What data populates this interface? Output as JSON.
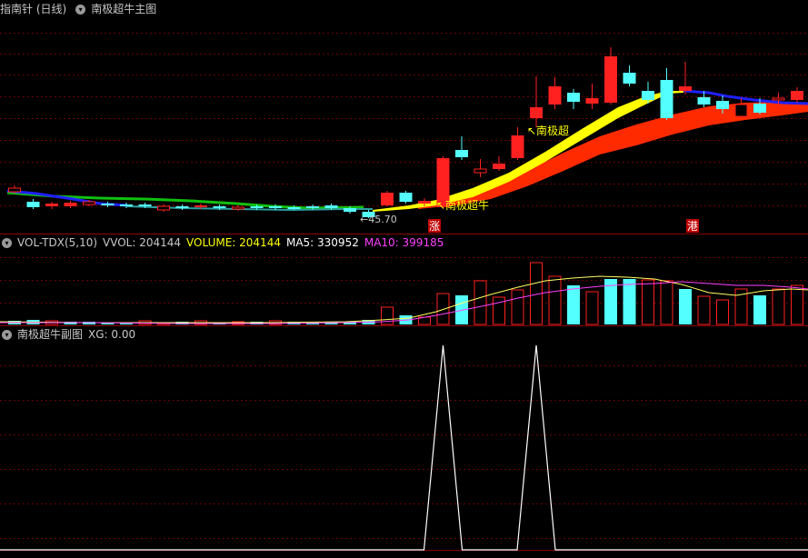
{
  "main_panel": {
    "title": "指南针 (日线)",
    "indicator": "南极超牛主图",
    "low_marker_label": "←45.70",
    "signal_label_1": "↖南极超牛",
    "signal_label_2": "↖南极超",
    "tag_zhang": "涨",
    "tag_gang": "港",
    "colors": {
      "up": "#ff2020",
      "down": "#54ffff",
      "band_yellow": "#ffff00",
      "band_red": "#ff2a00",
      "ma_blue": "#2020ff",
      "ma_green": "#10c010",
      "ma_teal": "#2aa0a0"
    }
  },
  "volume_panel": {
    "name": "VOL-TDX(5,10)",
    "vvol": "VVOL: 204144",
    "volume": "VOLUME: 204144",
    "ma5": "MA5: 330952",
    "ma10": "MA10: 399185",
    "colors": {
      "vvol": "#c8c8c8",
      "volume": "#ffff00",
      "ma5": "#ffffff",
      "ma10": "#ff40ff"
    }
  },
  "sub_panel": {
    "indicator": "南极超牛副图",
    "xg": "XG: 0.00"
  },
  "chart_data": {
    "type": "candlestick",
    "candles": [
      {
        "o": 207,
        "c": 211,
        "h": 204,
        "l": 213,
        "up": true
      },
      {
        "o": 222,
        "c": 228,
        "h": 219,
        "l": 230,
        "up": false
      },
      {
        "o": 227,
        "c": 224,
        "h": 222,
        "l": 230,
        "up": true
      },
      {
        "o": 227,
        "c": 223,
        "h": 221,
        "l": 229,
        "up": true
      },
      {
        "o": 222,
        "c": 225,
        "h": 220,
        "l": 227,
        "up": true
      },
      {
        "o": 224,
        "c": 226,
        "h": 222,
        "l": 228,
        "up": false
      },
      {
        "o": 225,
        "c": 227,
        "h": 223,
        "l": 229,
        "up": false
      },
      {
        "o": 225,
        "c": 227,
        "h": 223,
        "l": 229,
        "up": false
      },
      {
        "o": 227,
        "c": 231,
        "h": 225,
        "l": 233,
        "up": true
      },
      {
        "o": 227,
        "c": 229,
        "h": 225,
        "l": 231,
        "up": false
      },
      {
        "o": 228,
        "c": 226,
        "h": 224,
        "l": 230,
        "up": true
      },
      {
        "o": 227,
        "c": 229,
        "h": 225,
        "l": 231,
        "up": false
      },
      {
        "o": 228,
        "c": 230,
        "h": 226,
        "l": 232,
        "up": true
      },
      {
        "o": 227,
        "c": 229,
        "h": 225,
        "l": 231,
        "up": false
      },
      {
        "o": 227,
        "c": 229,
        "h": 225,
        "l": 231,
        "up": false
      },
      {
        "o": 228,
        "c": 229,
        "h": 226,
        "l": 231,
        "up": false
      },
      {
        "o": 227,
        "c": 229,
        "h": 225,
        "l": 231,
        "up": false
      },
      {
        "o": 226,
        "c": 229,
        "h": 224,
        "l": 231,
        "up": false
      },
      {
        "o": 229,
        "c": 233,
        "h": 227,
        "l": 235,
        "up": false
      },
      {
        "o": 233,
        "c": 239,
        "h": 231,
        "l": 240,
        "up": false
      },
      {
        "o": 226,
        "c": 212,
        "h": 210,
        "l": 227,
        "up": true
      },
      {
        "o": 222,
        "c": 212,
        "h": 210,
        "l": 224,
        "up": false
      },
      {
        "o": 224,
        "c": 221,
        "h": 218,
        "l": 227,
        "up": true
      },
      {
        "o": 228,
        "c": 174,
        "h": 172,
        "l": 230,
        "up": true
      },
      {
        "o": 165,
        "c": 173,
        "h": 150,
        "l": 176,
        "up": false
      },
      {
        "o": 186,
        "c": 190,
        "h": 175,
        "l": 195,
        "up": true
      },
      {
        "o": 186,
        "c": 180,
        "h": 172,
        "l": 188,
        "up": true
      },
      {
        "o": 174,
        "c": 149,
        "h": 140,
        "l": 176,
        "up": true
      },
      {
        "o": 130,
        "c": 118,
        "h": 84,
        "l": 140,
        "up": true
      },
      {
        "o": 115,
        "c": 95,
        "h": 85,
        "l": 120,
        "up": true
      },
      {
        "o": 112,
        "c": 102,
        "h": 98,
        "l": 120,
        "up": false
      },
      {
        "o": 114,
        "c": 108,
        "h": 92,
        "l": 120,
        "up": true
      },
      {
        "o": 113,
        "c": 62,
        "h": 52,
        "l": 115,
        "up": true
      },
      {
        "o": 80,
        "c": 92,
        "h": 72,
        "l": 95,
        "up": false
      },
      {
        "o": 100,
        "c": 110,
        "h": 90,
        "l": 114,
        "up": false
      },
      {
        "o": 88,
        "c": 130,
        "h": 75,
        "l": 132,
        "up": false
      },
      {
        "o": 100,
        "c": 95,
        "h": 68,
        "l": 104,
        "up": true
      },
      {
        "o": 107,
        "c": 115,
        "h": 100,
        "l": 118,
        "up": false
      },
      {
        "o": 111,
        "c": 120,
        "h": 105,
        "l": 125,
        "up": false
      },
      {
        "o": 115,
        "c": 128,
        "h": 108,
        "l": 130,
        "up": true
      },
      {
        "o": 114,
        "c": 124,
        "h": 108,
        "l": 126,
        "up": false
      },
      {
        "o": 108,
        "c": 110,
        "h": 102,
        "l": 116,
        "up": true
      },
      {
        "o": 110,
        "c": 100,
        "h": 96,
        "l": 113,
        "up": true
      }
    ],
    "volumes": [
      {
        "v": 353,
        "up": false
      },
      {
        "v": 352,
        "up": false
      },
      {
        "v": 353,
        "up": true
      },
      {
        "v": 354,
        "up": false
      },
      {
        "v": 354,
        "up": false
      },
      {
        "v": 355,
        "up": false
      },
      {
        "v": 355,
        "up": false
      },
      {
        "v": 353,
        "up": true
      },
      {
        "v": 355,
        "up": true
      },
      {
        "v": 354,
        "up": false
      },
      {
        "v": 353,
        "up": true
      },
      {
        "v": 355,
        "up": false
      },
      {
        "v": 354,
        "up": true
      },
      {
        "v": 354,
        "up": false
      },
      {
        "v": 353,
        "up": true
      },
      {
        "v": 354,
        "up": false
      },
      {
        "v": 354,
        "up": false
      },
      {
        "v": 354,
        "up": false
      },
      {
        "v": 354,
        "up": false
      },
      {
        "v": 352,
        "up": false
      },
      {
        "v": 338,
        "up": true
      },
      {
        "v": 347,
        "up": false
      },
      {
        "v": 349,
        "up": true
      },
      {
        "v": 323,
        "up": true
      },
      {
        "v": 325,
        "up": false
      },
      {
        "v": 309,
        "up": true
      },
      {
        "v": 327,
        "up": true
      },
      {
        "v": 319,
        "up": true
      },
      {
        "v": 289,
        "up": true
      },
      {
        "v": 304,
        "up": true
      },
      {
        "v": 314,
        "up": false
      },
      {
        "v": 321,
        "up": true
      },
      {
        "v": 307,
        "up": false
      },
      {
        "v": 307,
        "up": false
      },
      {
        "v": 308,
        "up": true
      },
      {
        "v": 309,
        "up": true
      },
      {
        "v": 318,
        "up": false
      },
      {
        "v": 326,
        "up": true
      },
      {
        "v": 330,
        "up": true
      },
      {
        "v": 318,
        "up": true
      },
      {
        "v": 325,
        "up": false
      },
      {
        "v": 318,
        "up": true
      },
      {
        "v": 314,
        "up": true
      }
    ],
    "xg": [
      0,
      0,
      0,
      0,
      0,
      0,
      0,
      0,
      0,
      0,
      0,
      0,
      0,
      0,
      0,
      0,
      0,
      0,
      0,
      0,
      0,
      0,
      0,
      1,
      0,
      0,
      0,
      0,
      1,
      0,
      0,
      0,
      0,
      0,
      0,
      0,
      0,
      0,
      0,
      0,
      0,
      0,
      0
    ]
  }
}
